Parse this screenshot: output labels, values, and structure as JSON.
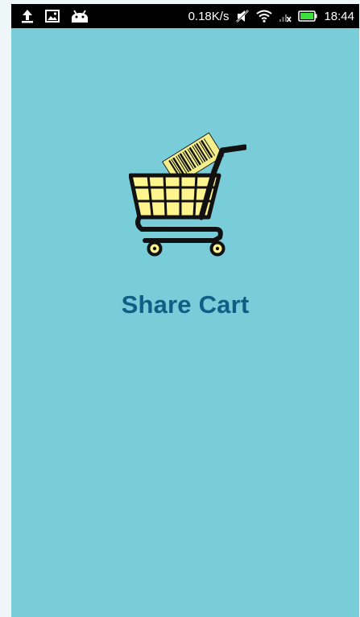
{
  "status_bar": {
    "left_icons": [
      "upload-icon",
      "image-notification-icon",
      "android-icon"
    ],
    "network_speed": "0.18K/s",
    "right_icons": [
      "mute-icon",
      "wifi-icon",
      "signal-icon",
      "battery-icon"
    ],
    "time": "18:44"
  },
  "splash": {
    "logo_icon": "shopping-cart-barcode-icon",
    "app_name": "Share Cart"
  },
  "colors": {
    "background": "#78cdd9",
    "app_name": "#0e5f86",
    "status_bar": "#000000",
    "cart_basket": "#fff58c",
    "cart_frame": "#000000",
    "battery": "#3ee03e"
  }
}
